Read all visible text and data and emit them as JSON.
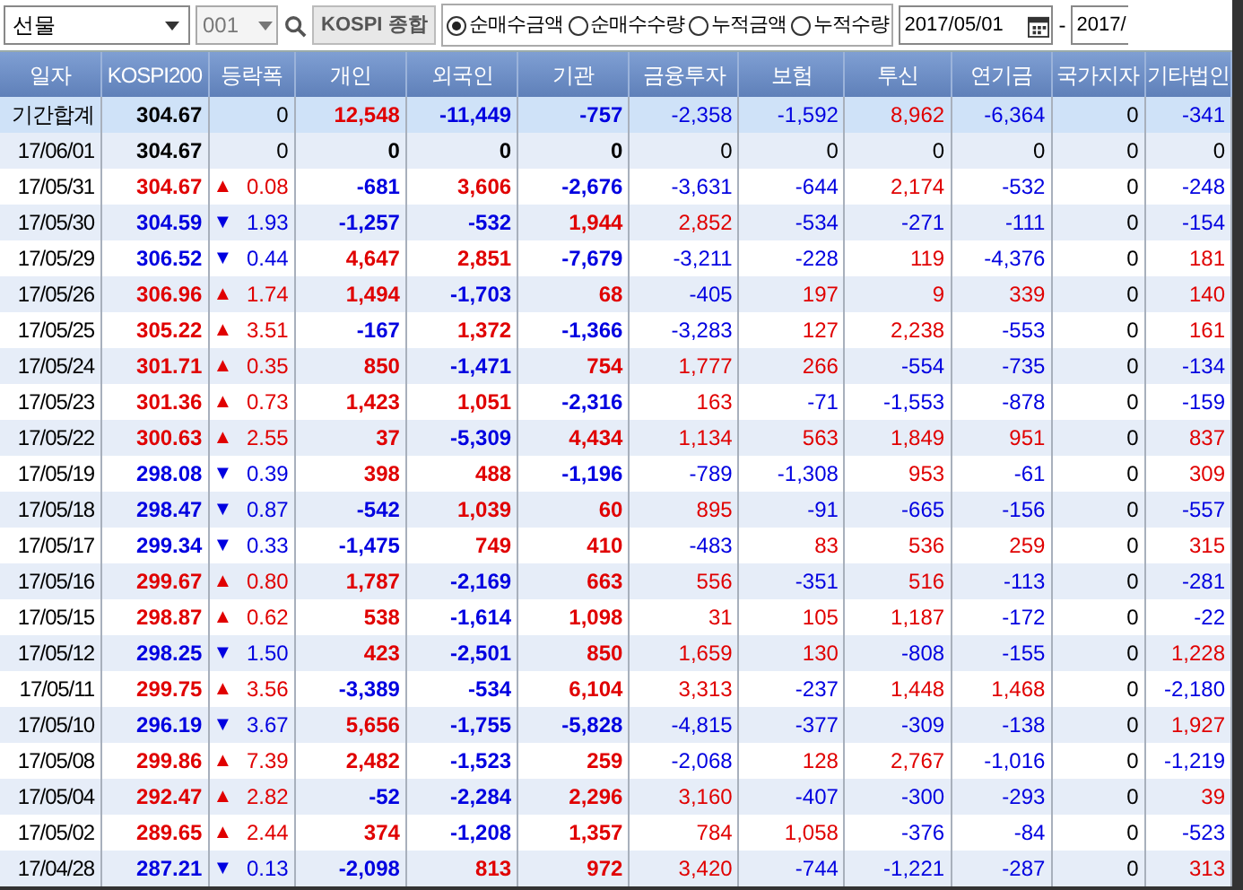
{
  "toolbar": {
    "market": "선물",
    "code": "001",
    "index_button": "KOSPI 종합",
    "radios": [
      {
        "label": "순매수금액",
        "selected": true
      },
      {
        "label": "순매수수량",
        "selected": false
      },
      {
        "label": "누적금액",
        "selected": false
      },
      {
        "label": "누적수량",
        "selected": false
      }
    ],
    "date_from": "2017/05/01",
    "separator": "-",
    "date_to": "2017/"
  },
  "table": {
    "columns": [
      "일자",
      "KOSPI200",
      "등락폭",
      "개인",
      "외국인",
      "기관",
      "금융투자",
      "보험",
      "투신",
      "연기금",
      "국가지자",
      "기타법인"
    ],
    "rows": [
      {
        "kind": "summary",
        "date": "기간합계",
        "kospi200": "304.67",
        "color": "#000000",
        "change": "0",
        "values": [
          "12,548",
          "-11,449",
          "-757",
          "-2,358",
          "-1,592",
          "8,962",
          "-6,364",
          "0",
          "-341"
        ]
      },
      {
        "kind": "day",
        "date": "17/06/01",
        "kospi200": "304.67",
        "color": "#000000",
        "change": "0",
        "values": [
          "0",
          "0",
          "0",
          "0",
          "0",
          "0",
          "0",
          "0",
          "0"
        ]
      },
      {
        "kind": "day",
        "date": "17/05/31",
        "kospi200": "304.67",
        "color": "#e00000",
        "arrow": "▲",
        "change": "0.08",
        "values": [
          "-681",
          "3,606",
          "-2,676",
          "-3,631",
          "-644",
          "2,174",
          "-532",
          "0",
          "-248"
        ]
      },
      {
        "kind": "day",
        "date": "17/05/30",
        "kospi200": "304.59",
        "color": "#0000e0",
        "arrow": "▼",
        "change": "1.93",
        "values": [
          "-1,257",
          "-532",
          "1,944",
          "2,852",
          "-534",
          "-271",
          "-111",
          "0",
          "-154"
        ]
      },
      {
        "kind": "day",
        "date": "17/05/29",
        "kospi200": "306.52",
        "color": "#0000e0",
        "arrow": "▼",
        "change": "0.44",
        "values": [
          "4,647",
          "2,851",
          "-7,679",
          "-3,211",
          "-228",
          "119",
          "-4,376",
          "0",
          "181"
        ]
      },
      {
        "kind": "day",
        "date": "17/05/26",
        "kospi200": "306.96",
        "color": "#e00000",
        "arrow": "▲",
        "change": "1.74",
        "values": [
          "1,494",
          "-1,703",
          "68",
          "-405",
          "197",
          "9",
          "339",
          "0",
          "140"
        ]
      },
      {
        "kind": "day",
        "date": "17/05/25",
        "kospi200": "305.22",
        "color": "#e00000",
        "arrow": "▲",
        "change": "3.51",
        "values": [
          "-167",
          "1,372",
          "-1,366",
          "-3,283",
          "127",
          "2,238",
          "-553",
          "0",
          "161"
        ]
      },
      {
        "kind": "day",
        "date": "17/05/24",
        "kospi200": "301.71",
        "color": "#e00000",
        "arrow": "▲",
        "change": "0.35",
        "values": [
          "850",
          "-1,471",
          "754",
          "1,777",
          "266",
          "-554",
          "-735",
          "0",
          "-134"
        ]
      },
      {
        "kind": "day",
        "date": "17/05/23",
        "kospi200": "301.36",
        "color": "#e00000",
        "arrow": "▲",
        "change": "0.73",
        "values": [
          "1,423",
          "1,051",
          "-2,316",
          "163",
          "-71",
          "-1,553",
          "-878",
          "0",
          "-159"
        ]
      },
      {
        "kind": "day",
        "date": "17/05/22",
        "kospi200": "300.63",
        "color": "#e00000",
        "arrow": "▲",
        "change": "2.55",
        "values": [
          "37",
          "-5,309",
          "4,434",
          "1,134",
          "563",
          "1,849",
          "951",
          "0",
          "837"
        ]
      },
      {
        "kind": "day",
        "date": "17/05/19",
        "kospi200": "298.08",
        "color": "#0000e0",
        "arrow": "▼",
        "change": "0.39",
        "values": [
          "398",
          "488",
          "-1,196",
          "-789",
          "-1,308",
          "953",
          "-61",
          "0",
          "309"
        ]
      },
      {
        "kind": "day",
        "date": "17/05/18",
        "kospi200": "298.47",
        "color": "#0000e0",
        "arrow": "▼",
        "change": "0.87",
        "values": [
          "-542",
          "1,039",
          "60",
          "895",
          "-91",
          "-665",
          "-156",
          "0",
          "-557"
        ]
      },
      {
        "kind": "day",
        "date": "17/05/17",
        "kospi200": "299.34",
        "color": "#0000e0",
        "arrow": "▼",
        "change": "0.33",
        "values": [
          "-1,475",
          "749",
          "410",
          "-483",
          "83",
          "536",
          "259",
          "0",
          "315"
        ]
      },
      {
        "kind": "day",
        "date": "17/05/16",
        "kospi200": "299.67",
        "color": "#e00000",
        "arrow": "▲",
        "change": "0.80",
        "values": [
          "1,787",
          "-2,169",
          "663",
          "556",
          "-351",
          "516",
          "-113",
          "0",
          "-281"
        ]
      },
      {
        "kind": "day",
        "date": "17/05/15",
        "kospi200": "298.87",
        "color": "#e00000",
        "arrow": "▲",
        "change": "0.62",
        "values": [
          "538",
          "-1,614",
          "1,098",
          "31",
          "105",
          "1,187",
          "-172",
          "0",
          "-22"
        ]
      },
      {
        "kind": "day",
        "date": "17/05/12",
        "kospi200": "298.25",
        "color": "#0000e0",
        "arrow": "▼",
        "change": "1.50",
        "values": [
          "423",
          "-2,501",
          "850",
          "1,659",
          "130",
          "-808",
          "-155",
          "0",
          "1,228"
        ]
      },
      {
        "kind": "day",
        "date": "17/05/11",
        "kospi200": "299.75",
        "color": "#e00000",
        "arrow": "▲",
        "change": "3.56",
        "values": [
          "-3,389",
          "-534",
          "6,104",
          "3,313",
          "-237",
          "1,448",
          "1,468",
          "0",
          "-2,180"
        ]
      },
      {
        "kind": "day",
        "date": "17/05/10",
        "kospi200": "296.19",
        "color": "#0000e0",
        "arrow": "▼",
        "change": "3.67",
        "values": [
          "5,656",
          "-1,755",
          "-5,828",
          "-4,815",
          "-377",
          "-309",
          "-138",
          "0",
          "1,927"
        ]
      },
      {
        "kind": "day",
        "date": "17/05/08",
        "kospi200": "299.86",
        "color": "#e00000",
        "arrow": "▲",
        "change": "7.39",
        "values": [
          "2,482",
          "-1,523",
          "259",
          "-2,068",
          "128",
          "2,767",
          "-1,016",
          "0",
          "-1,219"
        ]
      },
      {
        "kind": "day",
        "date": "17/05/04",
        "kospi200": "292.47",
        "color": "#e00000",
        "arrow": "▲",
        "change": "2.82",
        "values": [
          "-52",
          "-2,284",
          "2,296",
          "3,160",
          "-407",
          "-300",
          "-293",
          "0",
          "39"
        ]
      },
      {
        "kind": "day",
        "date": "17/05/02",
        "kospi200": "289.65",
        "color": "#e00000",
        "arrow": "▲",
        "change": "2.44",
        "values": [
          "374",
          "-1,208",
          "1,357",
          "784",
          "1,058",
          "-376",
          "-84",
          "0",
          "-523"
        ]
      },
      {
        "kind": "day",
        "date": "17/04/28",
        "kospi200": "287.21",
        "color": "#0000e0",
        "arrow": "▼",
        "change": "0.13",
        "values": [
          "-2,098",
          "813",
          "972",
          "3,420",
          "-744",
          "-1,221",
          "-287",
          "0",
          "313"
        ]
      }
    ]
  }
}
